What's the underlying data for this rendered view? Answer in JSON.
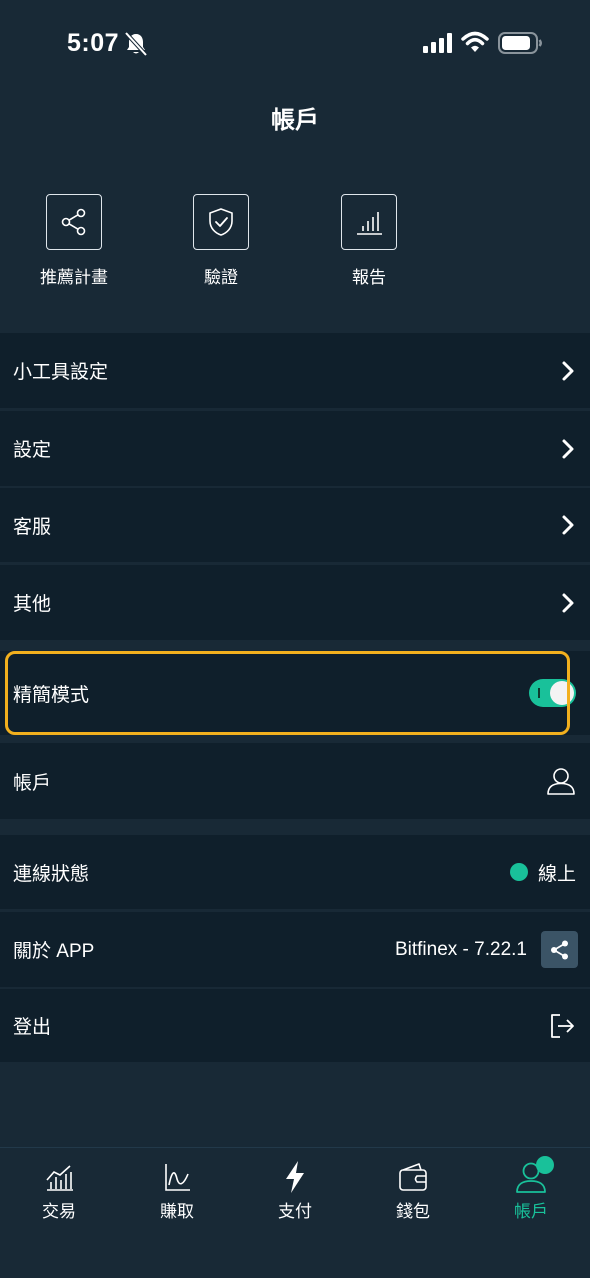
{
  "status_bar": {
    "time": "5:07"
  },
  "page_title": "帳戶",
  "quick_actions": [
    {
      "label": "推薦計畫",
      "icon": "share-network-icon"
    },
    {
      "label": "驗證",
      "icon": "shield-check-icon"
    },
    {
      "label": "報告",
      "icon": "bar-chart-icon"
    }
  ],
  "menu": {
    "widget_settings": "小工具設定",
    "settings": "設定",
    "support": "客服",
    "other": "其他",
    "simple_mode": {
      "label": "精簡模式",
      "enabled": true
    },
    "account": "帳戶",
    "connection": {
      "label": "連線狀態",
      "status": "線上"
    },
    "about": {
      "label": "關於 APP",
      "version": "Bitfinex - 7.22.1"
    },
    "logout": "登出"
  },
  "bottom_nav": [
    {
      "label": "交易",
      "icon": "trading-chart-icon"
    },
    {
      "label": "賺取",
      "icon": "earn-chart-icon"
    },
    {
      "label": "支付",
      "icon": "lightning-icon"
    },
    {
      "label": "錢包",
      "icon": "wallet-icon"
    },
    {
      "label": "帳戶",
      "icon": "account-icon",
      "active": true
    }
  ],
  "colors": {
    "accent": "#19c19a",
    "highlight": "#f2b01e",
    "background": "#182936",
    "row_background": "#0f1f2b"
  }
}
